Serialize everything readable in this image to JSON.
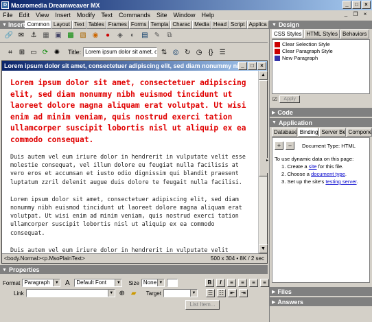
{
  "window": {
    "title": "Macromedia Dreamweaver MX"
  },
  "menu": [
    "File",
    "Edit",
    "View",
    "Insert",
    "Modify",
    "Text",
    "Commands",
    "Site",
    "Window",
    "Help"
  ],
  "insert": {
    "title": "Insert",
    "tabs": [
      "Common",
      "Layout",
      "Text",
      "Tables",
      "Frames",
      "Forms",
      "Templa",
      "Charac",
      "Media",
      "Head",
      "Script",
      "Applica"
    ]
  },
  "toolbar": {
    "title_label": "Title:",
    "title_value": "Lorem ipsum dolor sit amet, con"
  },
  "document": {
    "title": "Lorem ipsum dolor sit amet, consectetuer adipiscing elit, sed diam nonummy nibh eu",
    "red_paragraph": "Lorem ipsum dolor sit amet, consectetuer adipiscing elit, sed diam nonummy nibh euismod tincidunt ut laoreet dolore magna aliquam erat volutpat.  Ut wisi enim ad minim veniam, quis nostrud exerci tation ullamcorper suscipit lobortis nisl ut aliquip ex ea commodo consequat.",
    "para1": "Duis autem vel eum iriure dolor in hendrerit in vulputate velit esse molestie consequat, vel illum dolore eu feugiat nulla facilisis at vero eros et accumsan et iusto odio dignissim qui blandit praesent luptatum zzril delenit augue duis dolore te feugait nulla facilisi.",
    "para2": "Lorem ipsum dolor sit amet, consectetuer adipiscing elit, sed diam nonummy nibh euismod tincidunt ut laoreet dolore magna aliquam erat volutpat.  Ut wisi enim ad minim veniam, quis nostrud exerci tation ullamcorper suscipit lobortis nisl ut aliquip ex ea commodo consequat.",
    "para3": "Duis autem vel eum iriure dolor in hendrerit in vulputate velit",
    "status_tags": "<body.Normal><p.MsoPlainText>",
    "status_size": "500 x 304 • 8K / 2 sec"
  },
  "properties": {
    "title": "Properties",
    "format_label": "Format",
    "format_value": "Paragraph",
    "font_value": "Default Font",
    "size_label": "Size",
    "size_value": "None",
    "link_label": "Link",
    "target_label": "Target",
    "list_item_label": "List Item..."
  },
  "design": {
    "title": "Design",
    "tabs": [
      "CSS Styles",
      "HTML Styles",
      "Behaviors"
    ],
    "styles": [
      "Clear Selection Style",
      "Clear Paragraph Style",
      "New Paragraph"
    ],
    "apply_label": "Apply"
  },
  "code": {
    "title": "Code"
  },
  "application": {
    "title": "Application",
    "tabs": [
      "Databases",
      "Bindings",
      "Server Beh",
      "Componen"
    ],
    "doctype": "Document Type: HTML",
    "intro": "To use dynamic data on this page:",
    "step1_pre": "1. Create a ",
    "step1_link": "site",
    "step1_post": " for this file.",
    "step2_pre": "2. Choose a ",
    "step2_link": "document type",
    "step2_post": ".",
    "step3_pre": "3. Set up the site's ",
    "step3_link": "testing server",
    "step3_post": "."
  },
  "files": {
    "title": "Files"
  },
  "answers": {
    "title": "Answers"
  }
}
